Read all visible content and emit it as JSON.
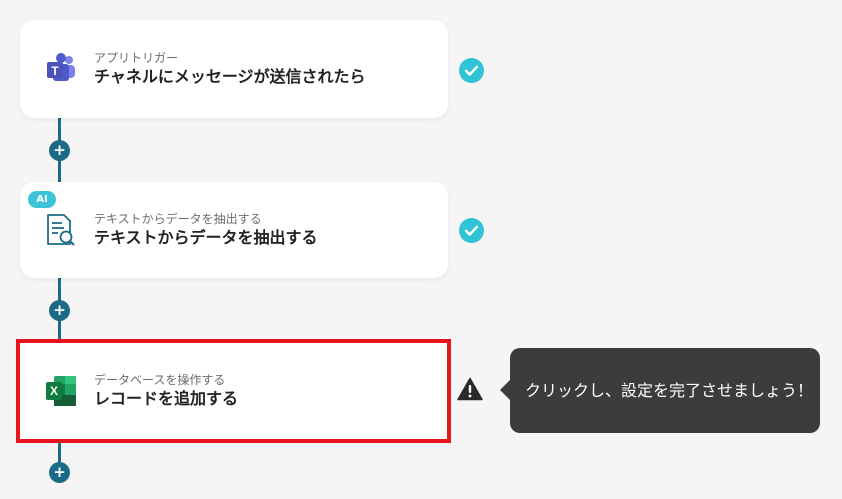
{
  "steps": [
    {
      "category": "アプリトリガー",
      "title": "チャネルにメッセージが送信されたら",
      "icon": "microsoft-teams-icon",
      "status": "completed"
    },
    {
      "badge": "AI",
      "category": "テキストからデータを抽出する",
      "title": "テキストからデータを抽出する",
      "icon": "document-search-icon",
      "status": "completed"
    },
    {
      "category": "データベースを操作する",
      "title": "レコードを追加する",
      "icon": "microsoft-excel-icon",
      "status": "warning"
    }
  ],
  "add_button_label": "+",
  "tooltip": {
    "text": "クリックし、設定を完了させましょう！"
  },
  "colors": {
    "connector": "#1b6b86",
    "check": "#2ec4d6",
    "highlight": "#e5141e",
    "tooltip_bg": "#3c3c3c"
  }
}
